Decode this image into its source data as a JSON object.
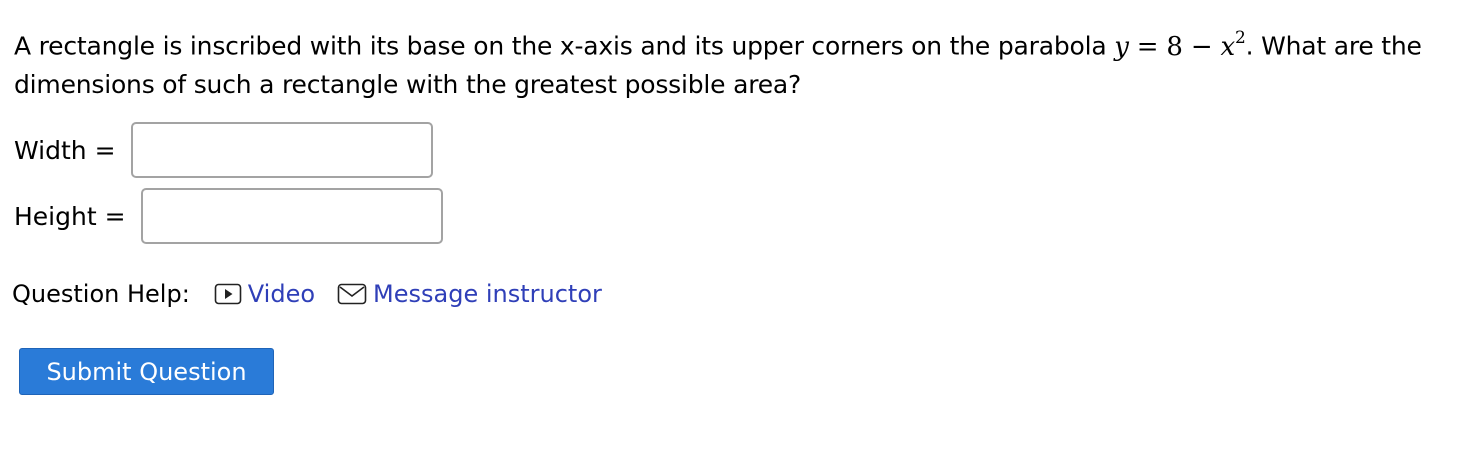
{
  "question": {
    "text_part1": "A rectangle is inscribed with its base on the x-axis and its upper corners on the parabola ",
    "math_var": "y",
    "math_eq": " = 8 − ",
    "math_x": "x",
    "math_exp": "2",
    "text_part2": ". What are the dimensions of such a rectangle with the greatest possible area?"
  },
  "fields": {
    "width_label": "Width = ",
    "width_value": "",
    "height_label": "Height = ",
    "height_value": ""
  },
  "help": {
    "label": "Question Help:",
    "video_label": "Video",
    "message_label": "Message instructor"
  },
  "submit_label": "Submit Question",
  "colors": {
    "link": "#2f3fb8",
    "button": "#2a7bd8"
  }
}
